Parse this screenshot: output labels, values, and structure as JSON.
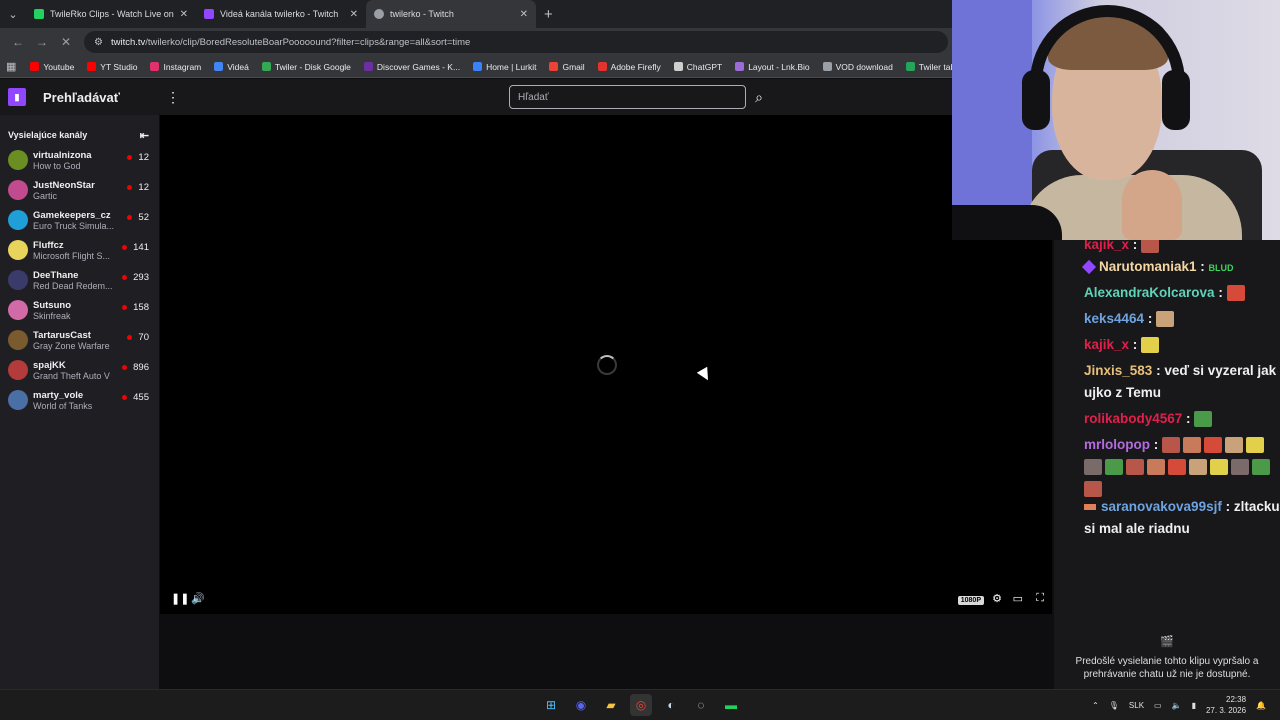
{
  "browser": {
    "tabs": [
      {
        "title": "TwileRko Clips - Watch Live on Twitch",
        "favicon_color": "#23d160",
        "active": false
      },
      {
        "title": "Videá kanála twilerko - Twitch",
        "favicon_color": "#9146ff",
        "active": false
      },
      {
        "title": "twilerko - Twitch",
        "favicon_color": "#9aa0a6",
        "active": true
      }
    ],
    "url_host": "twitch.tv",
    "url_path": "/twilerko/clip/BoredResoluteBoarPooooound?filter=clips&range=all&sort=time",
    "bookmarks": [
      {
        "label": "Youtube",
        "color": "#ff0000"
      },
      {
        "label": "YT Studio",
        "color": "#ff0000"
      },
      {
        "label": "Instagram",
        "color": "#e1306c"
      },
      {
        "label": "Videá",
        "color": "#4285f4"
      },
      {
        "label": "Twiler - Disk Google",
        "color": "#34a853"
      },
      {
        "label": "Discover Games - K...",
        "color": "#6b2fa3"
      },
      {
        "label": "Home | Lurkit",
        "color": "#3b82f6"
      },
      {
        "label": "Gmail",
        "color": "#ea4335"
      },
      {
        "label": "Adobe Firefly",
        "color": "#e5322d"
      },
      {
        "label": "ChatGPT",
        "color": "#cfcfcf"
      },
      {
        "label": "Layout - Lnk.Bio",
        "color": "#9b6bd6"
      },
      {
        "label": "VOD download",
        "color": "#9aa0a6"
      },
      {
        "label": "Twiler tabka",
        "color": "#23a55a"
      }
    ]
  },
  "twitch": {
    "browse_label": "Prehľadávať",
    "search_placeholder": "Hľadať",
    "sidebar_title": "Vysielajúce kanály",
    "channels": [
      {
        "name": "virtualnizona",
        "game": "How to God",
        "viewers": "12",
        "avatar_color": "#6b8e23"
      },
      {
        "name": "JustNeonStar",
        "game": "Gartic",
        "viewers": "12",
        "avatar_color": "#c24b8f"
      },
      {
        "name": "Gamekeepers_cz",
        "game": "Euro Truck Simula...",
        "viewers": "52",
        "avatar_color": "#1f9ed8"
      },
      {
        "name": "Fluffcz",
        "game": "Microsoft Flight S...",
        "viewers": "141",
        "avatar_color": "#e8d35b"
      },
      {
        "name": "DeeThane",
        "game": "Red Dead Redem...",
        "viewers": "293",
        "avatar_color": "#3b3b6b"
      },
      {
        "name": "Sutsuno",
        "game": "Skinfreak",
        "viewers": "158",
        "avatar_color": "#d26aa8"
      },
      {
        "name": "TartarusCast",
        "game": "Gray Zone Warfare",
        "viewers": "70",
        "avatar_color": "#7a5b2f"
      },
      {
        "name": "spajKK",
        "game": "Grand Theft Auto V",
        "viewers": "896",
        "avatar_color": "#b33b3b"
      },
      {
        "name": "marty_vole",
        "game": "World of Tanks",
        "viewers": "455",
        "avatar_color": "#4a6fa5"
      }
    ],
    "player": {
      "quality": "1080P"
    }
  },
  "chat": {
    "messages": [
      {
        "user": "kajik_x",
        "color": "#e0204a",
        "text": "",
        "emotes": 1
      },
      {
        "user": "Narutomaniak1",
        "color": "#f4d7a4",
        "text": "BLUD",
        "emotes": 0
      },
      {
        "user": "AlexandraKolcarova",
        "color": "#5fd3b8",
        "text": "",
        "emotes": 1
      },
      {
        "user": "keks4464",
        "color": "#6fa3e0",
        "text": "",
        "emotes": 1
      },
      {
        "user": "kajik_x",
        "color": "#e0204a",
        "text": "",
        "emotes": 1
      },
      {
        "user": "Jinxis_583",
        "color": "#e8c07a",
        "text": "veď si vyzeral jak ujko z Temu",
        "emotes": 0
      },
      {
        "user": "rolikabody4567",
        "color": "#e0204a",
        "text": "",
        "emotes": 1
      },
      {
        "user": "mrlolopop",
        "color": "#b46be0",
        "text": "",
        "emotes": 15
      },
      {
        "user": "saranovakova99sjf",
        "color": "#6fa3e0",
        "text": "zltacku si mal ale riadnu",
        "emotes": 0
      }
    ],
    "footer_text": "Predošlé vysielanie tohto klipu vypršalo a prehrávanie chatu už nie je dostupné."
  },
  "taskbar": {
    "language": "SLK",
    "time": "22:38",
    "date": "27. 3. 2026"
  }
}
